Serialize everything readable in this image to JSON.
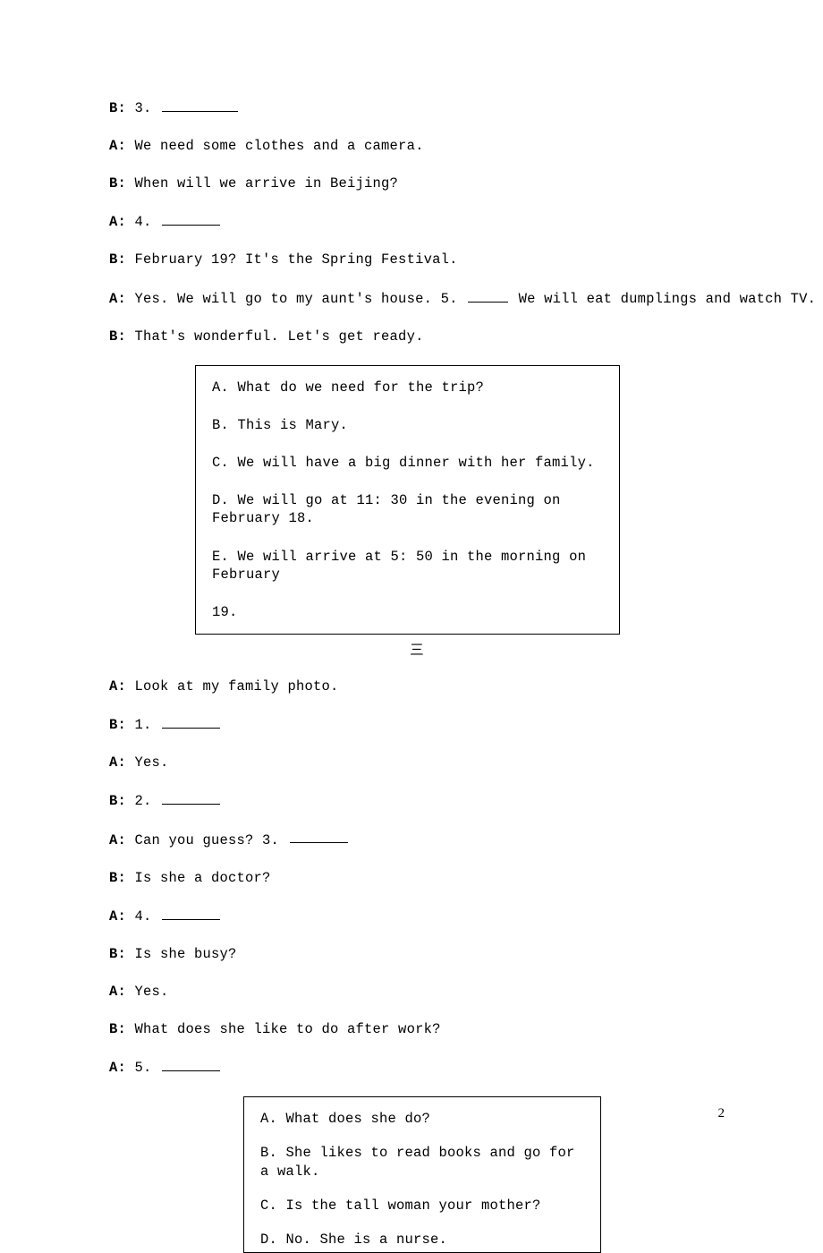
{
  "dialog2_cont": {
    "b3_prefix": "B: ",
    "b3_num": "3. ",
    "a3_prefix": "A: ",
    "a3_text": "We need some clothes and a camera.",
    "b4_prefix": "B: ",
    "b4_text": "When will we arrive in Beijing?",
    "a4_prefix": "A: ",
    "a4_num": "4. ",
    "b5_prefix": "B: ",
    "b5_text": "February 19? It's the Spring Festival.",
    "a5_prefix": "A: ",
    "a5_text_a": "Yes. We will go to my aunt's house. 5. ",
    "a5_text_b": " We will eat dumplings and watch TV.",
    "b6_prefix": "B: ",
    "b6_text": "That's wonderful. Let's get ready."
  },
  "choices2": {
    "a": "A. What do we need for the trip?",
    "b": "B. This is Mary.",
    "c": "C. We will have a big dinner with her family.",
    "d": "D. We will go at 11: 30 in the evening on February 18.",
    "e": "E. We will arrive at 5: 50 in the morning on February",
    "e2": "19."
  },
  "section3_label": "三",
  "dialog3": {
    "a1_prefix": "A: ",
    "a1_text": "Look at my family photo.",
    "b1_prefix": "B: ",
    "b1_num": "1. ",
    "a2_prefix": "A: ",
    "a2_text": "Yes.",
    "b2_prefix": "B: ",
    "b2_num": "2. ",
    "a3_prefix": "A: ",
    "a3_text": "Can you guess? 3. ",
    "b3_prefix": "B: ",
    "b3_text": "Is she a doctor?",
    "a4_prefix": "A: ",
    "a4_num": "4. ",
    "b4_prefix": "B: ",
    "b4_text": "Is she busy?",
    "a5_prefix": "A: ",
    "a5_text": "Yes.",
    "b5_prefix": "B: ",
    "b5_text": "What does she like to do after work?",
    "a6_prefix": "A: ",
    "a6_num": "5. "
  },
  "choices3": {
    "a": "A. What does she do?",
    "b": "B. She likes to read books and go for a walk.",
    "c": "C. Is the tall woman your mother?",
    "d": "D. No. She is a nurse."
  },
  "page_number": "2"
}
